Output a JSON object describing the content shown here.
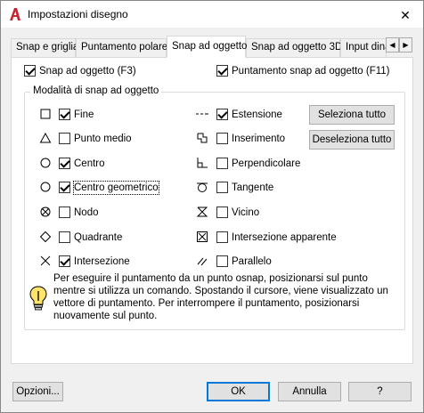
{
  "window": {
    "title": "Impostazioni disegno",
    "close_glyph": "✕",
    "accent_color": "#c4272f"
  },
  "tabs": [
    {
      "label": "Snap e griglia",
      "active": false
    },
    {
      "label": "Puntamento polare",
      "active": false
    },
    {
      "label": "Snap ad oggetto",
      "active": true
    },
    {
      "label": "Snap ad oggetto 3D",
      "active": false
    },
    {
      "label": "Input dina",
      "active": false
    }
  ],
  "tab_scroll": {
    "left": "◀",
    "right": "▶"
  },
  "top_options": {
    "osnap_label": "Snap ad oggetto (F3)",
    "osnap_checked": true,
    "tracking_label": "Puntamento snap ad oggetto (F11)",
    "tracking_checked": true
  },
  "group_label": "Modalità di snap ad oggetto",
  "modes_left": [
    {
      "label": "Fine",
      "checked": true,
      "icon": "square-icon"
    },
    {
      "label": "Punto medio",
      "checked": false,
      "icon": "triangle-icon"
    },
    {
      "label": "Centro",
      "checked": true,
      "icon": "circle-icon"
    },
    {
      "label": "Centro geometrico",
      "checked": true,
      "icon": "circle-icon"
    },
    {
      "label": "Nodo",
      "checked": false,
      "icon": "node-icon"
    },
    {
      "label": "Quadrante",
      "checked": false,
      "icon": "diamond-icon"
    },
    {
      "label": "Intersezione",
      "checked": true,
      "icon": "x-icon"
    }
  ],
  "modes_right": [
    {
      "label": "Estensione",
      "checked": true,
      "icon": "extension-icon"
    },
    {
      "label": "Inserimento",
      "checked": false,
      "icon": "insertion-icon"
    },
    {
      "label": "Perpendicolare",
      "checked": false,
      "icon": "perpendicular-icon"
    },
    {
      "label": "Tangente",
      "checked": false,
      "icon": "tangent-icon"
    },
    {
      "label": "Vicino",
      "checked": false,
      "icon": "nearest-icon"
    },
    {
      "label": "Intersezione apparente",
      "checked": false,
      "icon": "apparent-intersection-icon"
    },
    {
      "label": "Parallelo",
      "checked": false,
      "icon": "parallel-icon"
    }
  ],
  "buttons": {
    "select_all": "Seleziona tutto",
    "deselect_all": "Deseleziona tutto",
    "options": "Opzioni...",
    "ok": "OK",
    "cancel": "Annulla",
    "help": "?"
  },
  "info_text": "Per eseguire il puntamento da un punto osnap, posizionarsi sul punto mentre si utilizza un comando. Spostando il cursore, viene visualizzato un vettore di puntamento. Per interrompere il puntamento, posizionarsi nuovamente sul punto."
}
